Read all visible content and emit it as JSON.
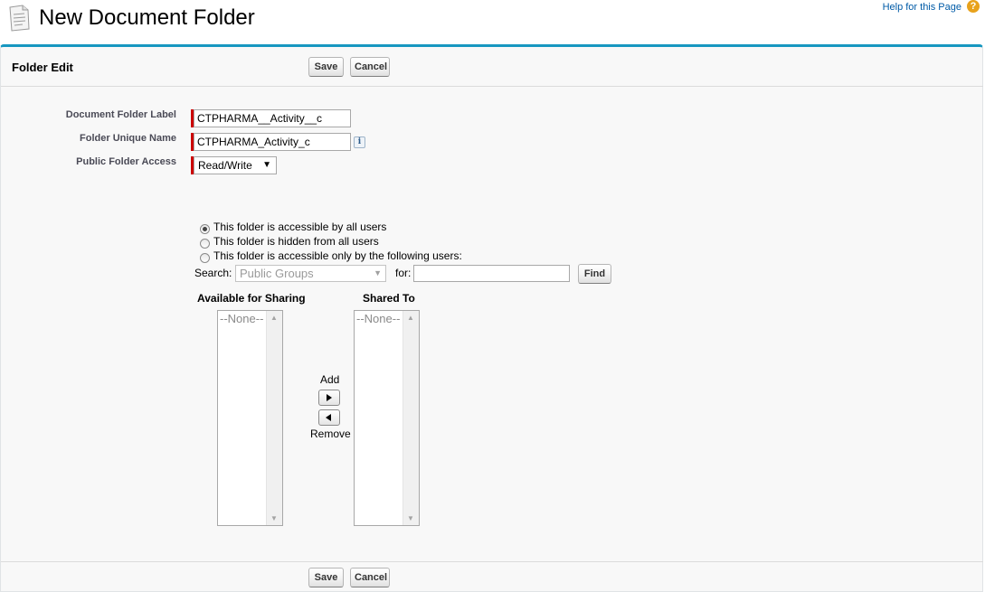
{
  "header": {
    "title": "New Document Folder",
    "help_link": "Help for this Page",
    "help_icon": "?"
  },
  "folder_edit": {
    "section_title": "Folder Edit",
    "save_label": "Save",
    "cancel_label": "Cancel"
  },
  "form": {
    "label_folder_label": "Document Folder Label",
    "value_folder_label": "CTPHARMA__Activity__c",
    "label_unique_name": "Folder Unique Name",
    "value_unique_name": "CTPHARMA_Activity_c",
    "info_icon": "i",
    "label_access": "Public Folder Access",
    "value_access": "Read/Write",
    "access_caret": "▼"
  },
  "visibility": {
    "option_all": "This folder is accessible by all users",
    "option_hidden": "This folder is hidden from all users",
    "option_some": "This folder is accessible only by the following users:",
    "selected": "all"
  },
  "search": {
    "label": "Search:",
    "dropdown_value": "Public Groups",
    "dropdown_caret": "▼",
    "for_label": "for:",
    "query": "",
    "find_label": "Find"
  },
  "sharing": {
    "available_heading": "Available for Sharing",
    "available_items": [
      "--None--"
    ],
    "shared_heading": "Shared To",
    "shared_items": [
      "--None--"
    ],
    "add_label": "Add",
    "remove_label": "Remove",
    "scroll_up": "▲",
    "scroll_down": "▼"
  },
  "footer": {
    "save_label": "Save",
    "cancel_label": "Cancel"
  }
}
